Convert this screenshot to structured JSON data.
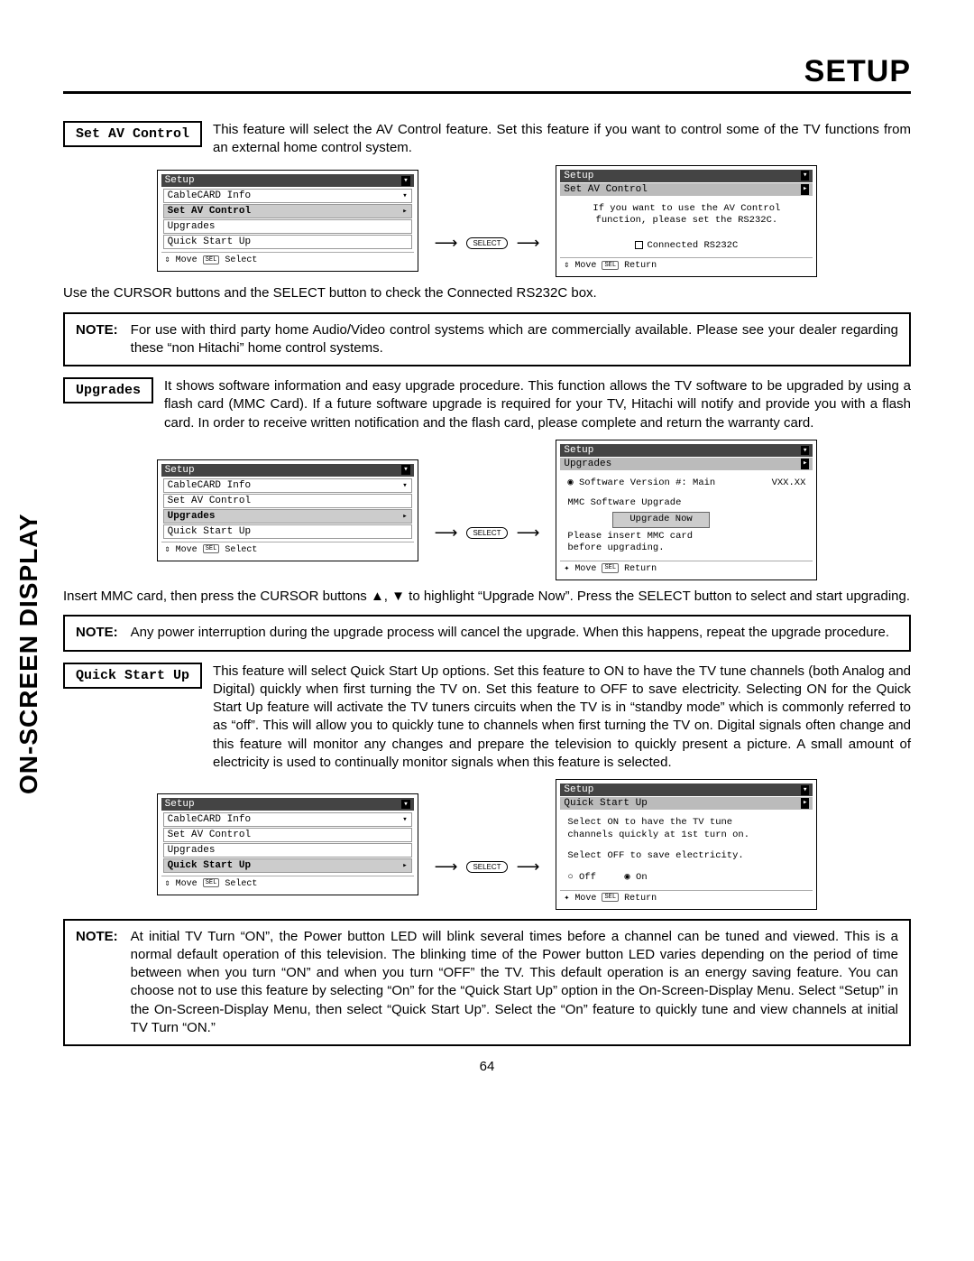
{
  "page": {
    "title": "SETUP",
    "side_label": "ON-SCREEN DISPLAY",
    "number": "64"
  },
  "av": {
    "box": "Set AV Control",
    "para": "This feature will select the AV Control feature.  Set this feature if you want to control some of the TV functions from an external home control system.",
    "menu": {
      "title": "Setup",
      "items": [
        "CableCARD Info",
        "Set AV Control",
        "Upgrades",
        "Quick Start Up"
      ],
      "highlight": 1,
      "foot": "Move",
      "foot2": "Select"
    },
    "detail": {
      "title": "Setup",
      "sub": "Set AV Control",
      "line1": "If you want to use the AV Control",
      "line2": "function, please set the RS232C.",
      "check": "Connected RS232C",
      "foot": "Move",
      "foot2": "Return"
    },
    "after": "Use the CURSOR buttons and the SELECT button to check the Connected RS232C box.",
    "note": "For use with third party home Audio/Video control systems which are commercially available.  Please see your dealer regarding these “non Hitachi” home control systems."
  },
  "up": {
    "box": "Upgrades",
    "para": "It shows software information and easy upgrade procedure.  This function allows the TV software to be upgraded by using a flash card (MMC Card).  If a future software upgrade is required for your TV, Hitachi will notify and provide you with a flash card.  In order to receive written notification and the flash card, please complete and return the warranty card.",
    "menu": {
      "title": "Setup",
      "items": [
        "CableCARD Info",
        "Set AV Control",
        "Upgrades",
        "Quick Start Up"
      ],
      "highlight": 2,
      "foot": "Move",
      "foot2": "Select"
    },
    "detail": {
      "title": "Setup",
      "sub": "Upgrades",
      "ver_label": "Software Version #: Main",
      "ver_val": "VXX.XX",
      "mmc": "MMC Software Upgrade",
      "btn": "Upgrade Now",
      "p1": "Please insert MMC card",
      "p2": "before upgrading.",
      "foot": "Move",
      "foot2": "Return"
    },
    "after": "Insert MMC card, then press the CURSOR buttons ▲, ▼ to highlight “Upgrade Now”.  Press the SELECT button to select and start upgrading.",
    "note": "Any power interruption during the upgrade process will cancel the upgrade.  When this happens, repeat the upgrade procedure."
  },
  "qs": {
    "box": "Quick Start Up",
    "para": "This feature will select Quick Start Up options.  Set this feature to ON to have the TV tune channels (both Analog and Digital) quickly when first turning the TV on.  Set this feature to OFF to save electricity.  Selecting ON for the Quick Start Up feature will activate the TV tuners circuits when the TV is in “standby mode” which is commonly referred to as “off”.  This will allow you to quickly tune to channels when first turning the TV on.  Digital signals often change and this feature will monitor any changes and prepare the television to quickly present a picture.  A small amount of electricity is used to continually monitor signals when this feature is selected.",
    "menu": {
      "title": "Setup",
      "items": [
        "CableCARD Info",
        "Set AV Control",
        "Upgrades",
        "Quick Start Up"
      ],
      "highlight": 3,
      "foot": "Move",
      "foot2": "Select"
    },
    "detail": {
      "title": "Setup",
      "sub": "Quick Start Up",
      "l1": "Select ON to have the TV tune",
      "l2": "channels quickly at 1st turn on.",
      "l3": "Select OFF to save electricity.",
      "off": "Off",
      "on": "On",
      "foot": "Move",
      "foot2": "Return"
    },
    "note": "At initial TV Turn “ON”, the Power button LED will blink several times before a channel can be tuned and viewed. This is a normal default operation of this television. The blinking time of the Power button LED varies depending on the period of time between when you turn “ON” and when you turn “OFF” the TV. This default operation is an energy saving feature. You can choose not to use this feature by selecting “On” for the “Quick Start Up” option in the On-Screen-Display Menu. Select “Setup” in the On-Screen-Display Menu, then select “Quick Start Up”. Select the “On” feature to quickly tune and view channels at initial TV Turn “ON.”"
  },
  "labels": {
    "select": "SELECT",
    "note": "NOTE:"
  }
}
